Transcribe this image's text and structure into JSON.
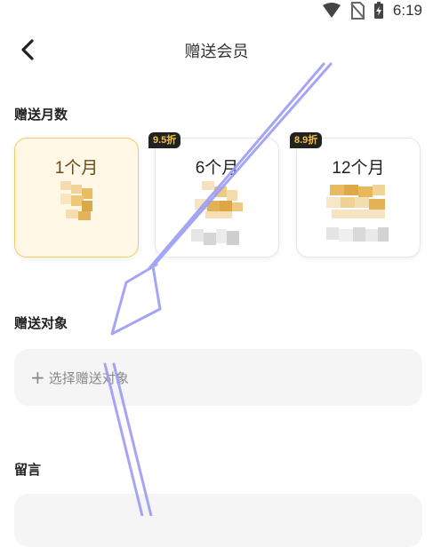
{
  "status_bar": {
    "time": "6:19"
  },
  "header": {
    "title": "赠送会员"
  },
  "months_section": {
    "label": "赠送月数"
  },
  "plans": [
    {
      "name": "1个月",
      "badge": "",
      "selected": true
    },
    {
      "name": "6个月",
      "badge": "9.5折",
      "selected": false
    },
    {
      "name": "12个月",
      "badge": "8.9折",
      "selected": false
    }
  ],
  "target_section": {
    "label": "赠送对象",
    "placeholder": "选择赠送对象"
  },
  "message_section": {
    "label": "留言"
  },
  "colors": {
    "accent": "#f2cb66",
    "selected_bg": "#fff8e6",
    "badge_text": "#f5c248",
    "gesture_arrow": "#9c9cf5"
  }
}
